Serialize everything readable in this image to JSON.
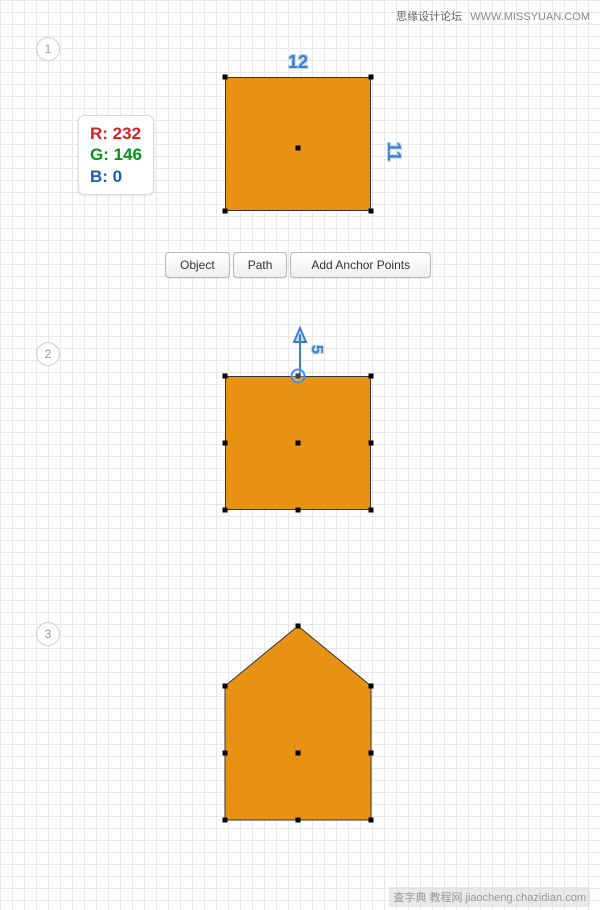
{
  "watermark": {
    "cn": "思缘设计论坛",
    "url": "WWW.MISSYUAN.COM"
  },
  "bottom_watermark": "查字典 教程网 jiaocheng.chazidian.com",
  "steps": {
    "s1": "1",
    "s2": "2",
    "s3": "3"
  },
  "color": {
    "r_label": "R: 232",
    "g_label": "G: 146",
    "b_label": "B: 0"
  },
  "dimensions": {
    "width": "12",
    "height": "11",
    "arrow": "5"
  },
  "buttons": {
    "object": "Object",
    "path": "Path",
    "add_anchor": "Add Anchor Points"
  },
  "shape_fill": "#e89214"
}
